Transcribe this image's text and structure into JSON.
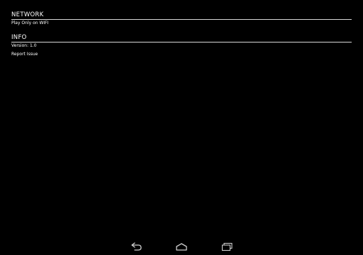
{
  "sections": [
    {
      "title": "NETWORK",
      "items": [
        {
          "label": "Play Only on WIFI"
        }
      ]
    },
    {
      "title": "INFO",
      "items": [
        {
          "label": "Version: 1.0"
        },
        {
          "label": "Report Issue"
        }
      ]
    }
  ],
  "navbar": {
    "back_icon": "back-icon",
    "home_icon": "home-icon",
    "recents_icon": "recent-apps-icon"
  },
  "colors": {
    "background": "#000000",
    "text": "#ffffff",
    "divider": "#d8d8d8",
    "nav_icon": "#cfcfcf"
  }
}
